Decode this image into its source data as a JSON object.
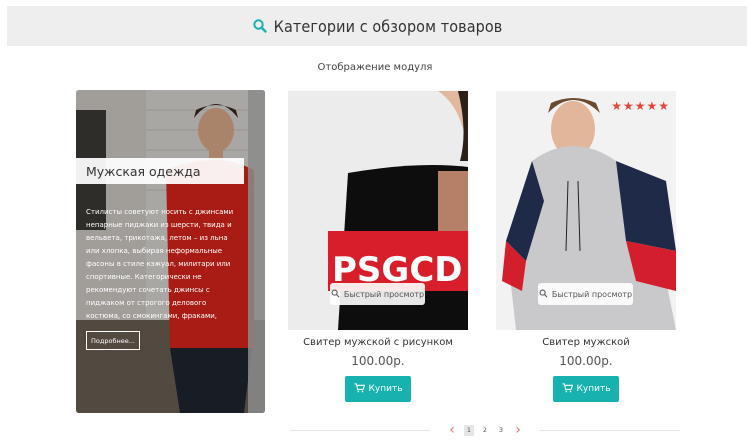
{
  "header": {
    "title": "Категории с обзором товаров",
    "icon": "search-icon",
    "accent": "#17b2b0"
  },
  "module_label": "Отображение модуля",
  "category": {
    "title": "Мужская одежда",
    "description": "Стилисты советуют носить с джинсами непарные пиджаки из шерсти, твида и вельвета, трикотажа, летом – из льна или хлопка, выбирая неформальные фасоны в стиле кэжуал, милитари или спортивные. Категорически не рекомендуют сочетать джинсы с пиджаком от строгого делового костюма, со смокингами, фраками,",
    "more_label": "Подробнее..."
  },
  "products": [
    {
      "name": "Свитер мужской с рисунком",
      "price": "100.00р.",
      "buy_label": "Купить",
      "quickview_label": "Быстрый просмотр",
      "image_print": "PSGCD"
    },
    {
      "name": "Свитер мужской",
      "price": "100.00р.",
      "buy_label": "Купить",
      "quickview_label": "Быстрый просмотр",
      "rating": 5,
      "rating_max": 5
    }
  ],
  "pagination": {
    "pages": [
      "1",
      "2",
      "3"
    ],
    "current": "1"
  },
  "colors": {
    "button": "#17b2b0",
    "stars": "#e4463e",
    "arrows": "#e16a6a"
  }
}
